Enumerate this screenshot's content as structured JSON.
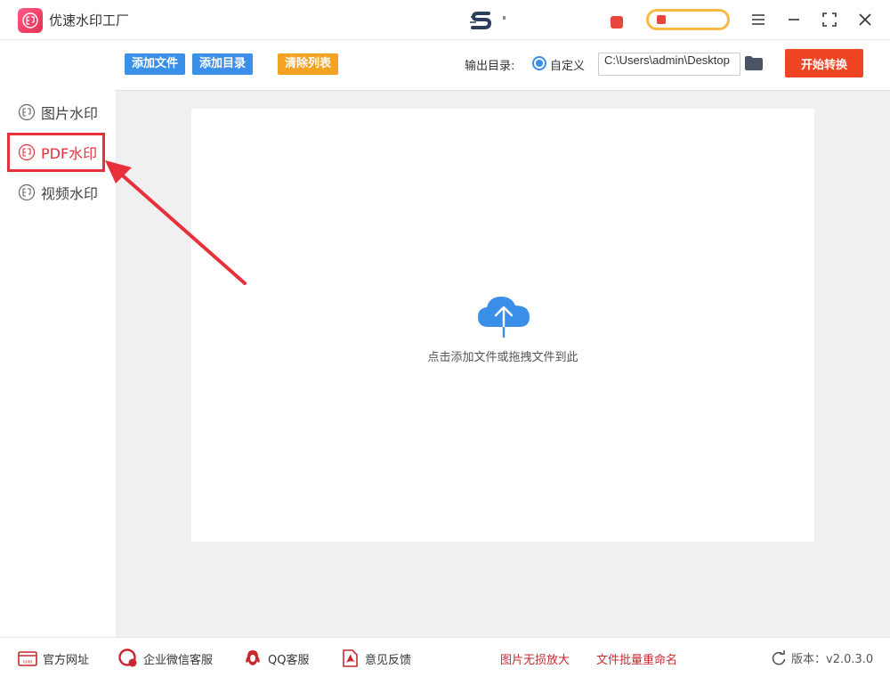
{
  "app": {
    "title": "优速水印工厂"
  },
  "sidebar": {
    "items": [
      {
        "label": "图片水印",
        "active": false
      },
      {
        "label": "PDF水印",
        "active": true
      },
      {
        "label": "视频水印",
        "active": false
      }
    ]
  },
  "toolbar": {
    "add_file": "添加文件",
    "add_dir": "添加目录",
    "clear_list": "清除列表",
    "output_label": "输出目录:",
    "custom_label": "自定义",
    "output_path": "C:\\Users\\admin\\Desktop",
    "start": "开始转换"
  },
  "main": {
    "drop_hint": "点击添加文件或拖拽文件到此"
  },
  "footer": {
    "website": "官方网址",
    "wechat": "企业微信客服",
    "qq": "QQ客服",
    "feedback": "意见反馈",
    "link1": "图片无损放大",
    "link2": "文件批量重命名",
    "version": "版本：v2.0.3.0"
  },
  "colors": {
    "accent": "#3a8fe8",
    "danger": "#e8303a",
    "start": "#f04523",
    "clear": "#f3a221"
  }
}
